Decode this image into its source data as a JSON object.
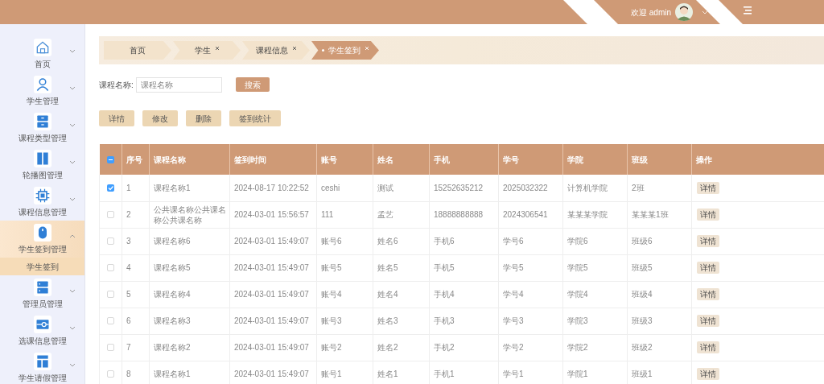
{
  "header": {
    "welcome": "欢迎 admin"
  },
  "sidebar": {
    "items": [
      {
        "label": "首页",
        "expanded": false
      },
      {
        "label": "学生管理",
        "expanded": false
      },
      {
        "label": "课程类型管理",
        "expanded": false
      },
      {
        "label": "轮播图管理",
        "expanded": false
      },
      {
        "label": "课程信息管理",
        "expanded": false
      },
      {
        "label": "学生签到管理",
        "expanded": true,
        "children": [
          {
            "label": "学生签到",
            "selected": true
          }
        ]
      },
      {
        "label": "管理员管理",
        "expanded": false
      },
      {
        "label": "选课信息管理",
        "expanded": false
      },
      {
        "label": "学生请假管理",
        "expanded": false
      }
    ]
  },
  "tabs": [
    {
      "label": "首页",
      "selected": false,
      "closable": false
    },
    {
      "label": "学生",
      "selected": false,
      "closable": true
    },
    {
      "label": "课程信息",
      "selected": false,
      "closable": true
    },
    {
      "label": "学生签到",
      "selected": true,
      "closable": true
    }
  ],
  "search": {
    "label": "课程名称:",
    "placeholder": "课程名称",
    "button": "搜索"
  },
  "actions": [
    "详情",
    "修改",
    "删除",
    "签到统计"
  ],
  "table": {
    "indeterminate": true,
    "columns": [
      "序号",
      "课程名称",
      "签到时间",
      "账号",
      "姓名",
      "手机",
      "学号",
      "学院",
      "班级",
      "操作"
    ],
    "rows": [
      {
        "checked": true,
        "cells": [
          "1",
          "课程名称1",
          "2024-08-17 10:22:52",
          "ceshi",
          "测试",
          "15252635212",
          "2025032322",
          "计算机学院",
          "2班"
        ],
        "action": "详情"
      },
      {
        "checked": false,
        "cells": [
          "2",
          "公共课名称公共课名称公共课名称",
          "2024-03-01 15:56:57",
          "111",
          "孟艺",
          "18888888888",
          "2024306541",
          "某某某学院",
          "某某某1班"
        ],
        "action": "详情"
      },
      {
        "checked": false,
        "cells": [
          "3",
          "课程名称6",
          "2024-03-01 15:49:07",
          "账号6",
          "姓名6",
          "手机6",
          "学号6",
          "学院6",
          "班级6"
        ],
        "action": "详情"
      },
      {
        "checked": false,
        "cells": [
          "4",
          "课程名称5",
          "2024-03-01 15:49:07",
          "账号5",
          "姓名5",
          "手机5",
          "学号5",
          "学院5",
          "班级5"
        ],
        "action": "详情"
      },
      {
        "checked": false,
        "cells": [
          "5",
          "课程名称4",
          "2024-03-01 15:49:07",
          "账号4",
          "姓名4",
          "手机4",
          "学号4",
          "学院4",
          "班级4"
        ],
        "action": "详情"
      },
      {
        "checked": false,
        "cells": [
          "6",
          "课程名称3",
          "2024-03-01 15:49:07",
          "账号3",
          "姓名3",
          "手机3",
          "学号3",
          "学院3",
          "班级3"
        ],
        "action": "详情"
      },
      {
        "checked": false,
        "cells": [
          "7",
          "课程名称2",
          "2024-03-01 15:49:07",
          "账号2",
          "姓名2",
          "手机2",
          "学号2",
          "学院2",
          "班级2"
        ],
        "action": "详情"
      },
      {
        "checked": false,
        "cells": [
          "8",
          "课程名称1",
          "2024-03-01 15:49:07",
          "账号1",
          "姓名1",
          "手机1",
          "学号1",
          "学院1",
          "班级1"
        ],
        "action": "详情"
      }
    ]
  }
}
